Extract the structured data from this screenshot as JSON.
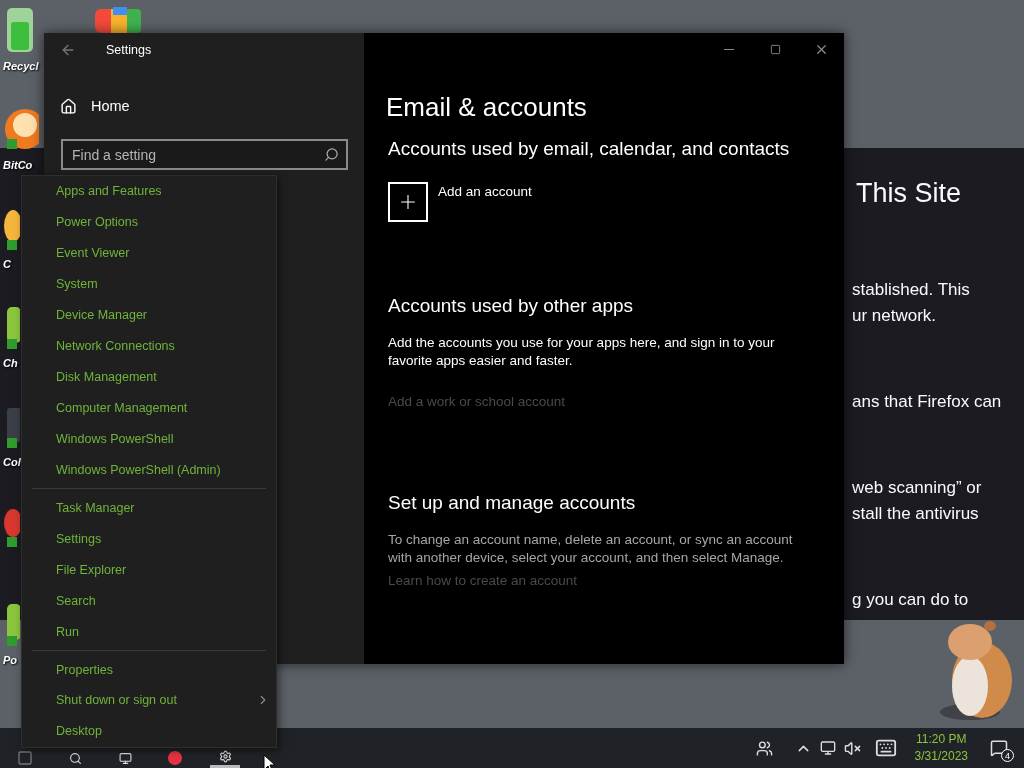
{
  "desktop": {
    "icons": [
      {
        "label": "Recycl",
        "kind": "bin"
      },
      {
        "label": "BitCo",
        "kind": "torrent"
      },
      {
        "label": "C",
        "kind": "flame"
      },
      {
        "label": "Ch",
        "kind": "leaf"
      },
      {
        "label": "Col",
        "kind": "dark"
      },
      {
        "kind": "red"
      },
      {
        "label": "Po",
        "kind": "leaf"
      }
    ]
  },
  "browser": {
    "heading": "This Site",
    "paragraphs": [
      [
        "stablished. This",
        "ur network."
      ],
      [
        "ans that Firefox can"
      ],
      [
        "web scanning” or",
        "stall the antivirus"
      ],
      [
        "g you can do to"
      ]
    ]
  },
  "settings": {
    "title": "Settings",
    "home": "Home",
    "search": {
      "placeholder": "Find a setting"
    },
    "page_title": "Email & accounts",
    "sections": [
      {
        "heading": "Accounts used by email, calendar, and contacts",
        "add_button": "Add an account"
      },
      {
        "heading": "Accounts used by other apps",
        "body": "Add the accounts you use for your apps here, and sign in to your favorite apps easier and faster.",
        "body_muted": false,
        "link": {
          "label": "Add a work or school account",
          "disabled": true
        }
      },
      {
        "heading": "Set up and manage accounts",
        "body": "To change an account name, delete an account, or sync an account with another device, select your account, and then select Manage.",
        "body_muted": true,
        "link": {
          "label": "Learn how to create an account",
          "disabled": true
        }
      }
    ]
  },
  "winx_menu": {
    "groups": [
      [
        {
          "label": "Apps and Features",
          "submenu": false
        },
        {
          "label": "Power Options",
          "submenu": false
        },
        {
          "label": "Event Viewer",
          "submenu": false
        },
        {
          "label": "System",
          "submenu": false
        },
        {
          "label": "Device Manager",
          "submenu": false
        },
        {
          "label": "Network Connections",
          "submenu": false
        },
        {
          "label": "Disk Management",
          "submenu": false
        },
        {
          "label": "Computer Management",
          "submenu": false
        },
        {
          "label": "Windows PowerShell",
          "submenu": false
        },
        {
          "label": "Windows PowerShell (Admin)",
          "submenu": false
        }
      ],
      [
        {
          "label": "Task Manager",
          "submenu": false
        },
        {
          "label": "Settings",
          "submenu": false
        },
        {
          "label": "File Explorer",
          "submenu": false
        },
        {
          "label": "Search",
          "submenu": false
        },
        {
          "label": "Run",
          "submenu": false
        }
      ],
      [
        {
          "label": "Properties",
          "submenu": false
        },
        {
          "label": "Shut down or sign out",
          "submenu": true
        },
        {
          "label": "Desktop",
          "submenu": false
        }
      ]
    ]
  },
  "taskbar": {
    "time": "11:20 PM",
    "date": "3/31/2023",
    "notification_count": "4"
  }
}
